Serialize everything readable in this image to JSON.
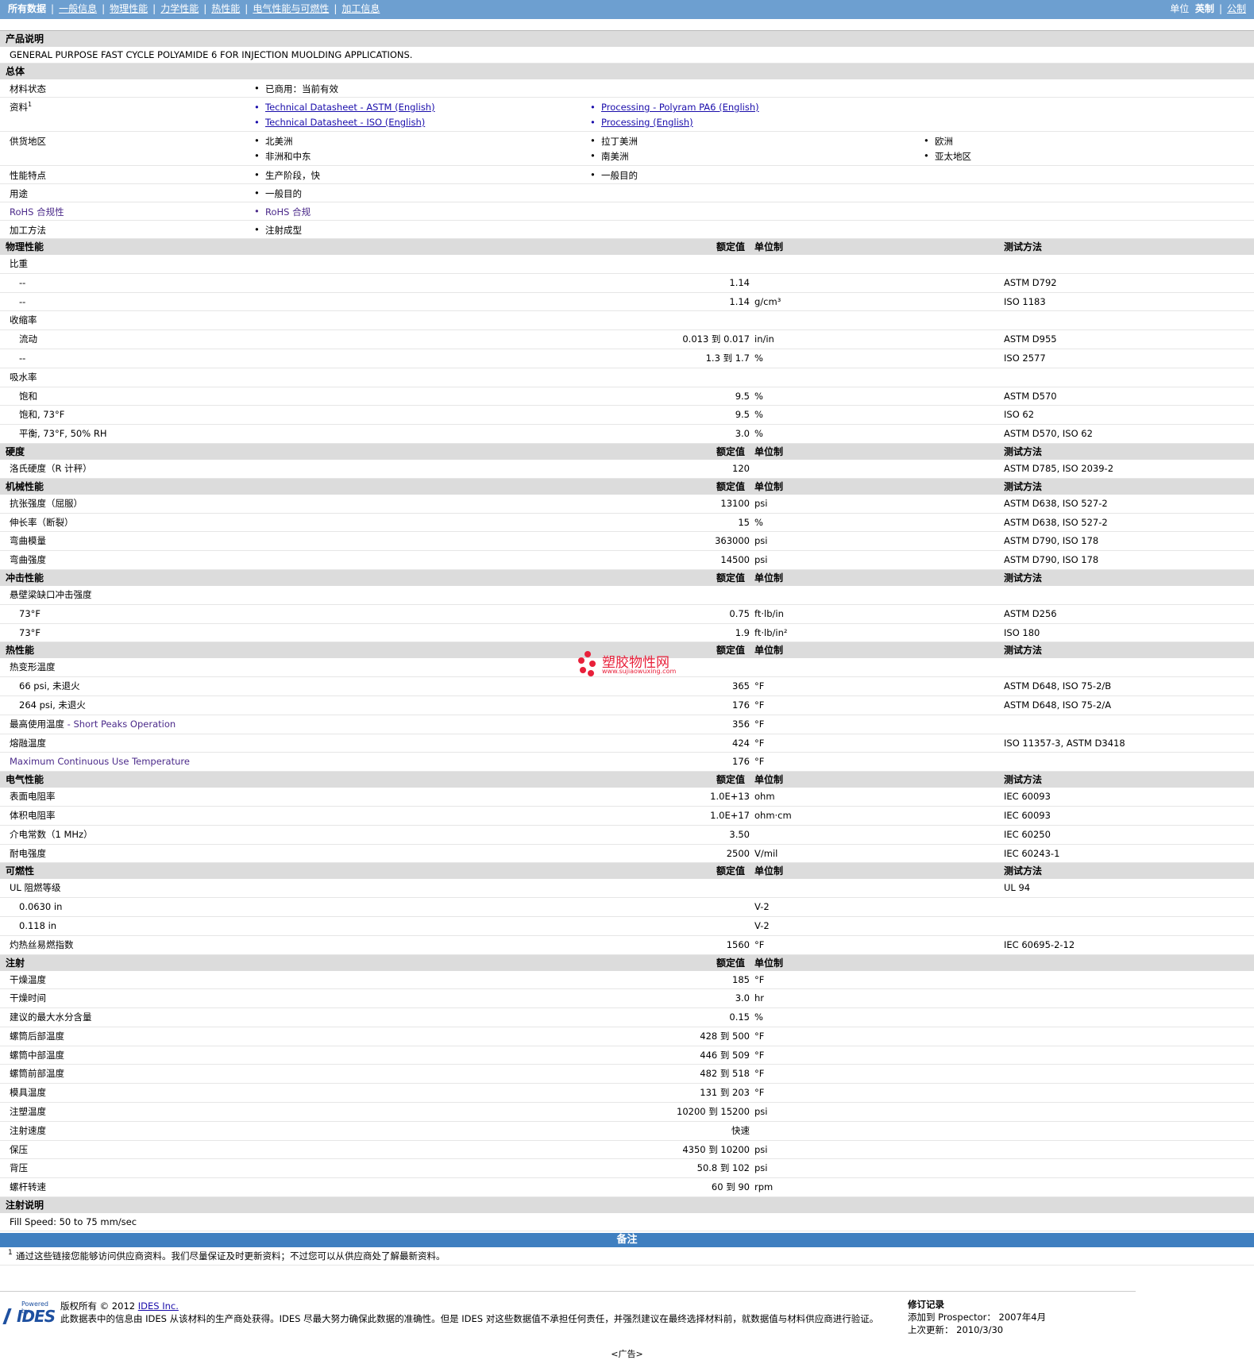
{
  "nav": {
    "items": [
      "所有数据",
      "一般信息",
      "物理性能",
      "力学性能",
      "热性能",
      "电气性能与可燃性",
      "加工信息"
    ],
    "units_label": "单位",
    "units_imperial": "英制",
    "units_metric": "公制"
  },
  "product_desc": {
    "header": "产品说明",
    "text": "GENERAL PURPOSE FAST CYCLE POLYAMIDE 6 FOR INJECTION MUOLDING APPLICATIONS."
  },
  "general": {
    "header": "总体",
    "material_status_label": "材料状态",
    "material_status": "已商用：当前有效",
    "docs_label": "资料",
    "docs_sup": "1",
    "docs": [
      "Technical Datasheet - ASTM (English)",
      "Processing - Polyram PA6 (English)",
      "Technical Datasheet - ISO (English)",
      "Processing (English)"
    ],
    "regions_label": "供货地区",
    "regions": [
      "北美洲",
      "拉丁美洲",
      "欧洲",
      "非洲和中东",
      "南美洲",
      "亚太地区"
    ],
    "features_label": "性能特点",
    "features": [
      "生产阶段，快",
      "一般目的"
    ],
    "uses_label": "用途",
    "uses": "一般目的",
    "rohs_label": "RoHS 合规性",
    "rohs": "RoHS 合规",
    "process_label": "加工方法",
    "process": "注射成型"
  },
  "col_headers": {
    "value": "额定值",
    "unit": "单位制",
    "method": "测试方法"
  },
  "sections": [
    {
      "title": "物理性能",
      "rows": [
        {
          "label": "比重"
        },
        {
          "label": "--",
          "indent": true,
          "value": "1.14",
          "unit": "",
          "method": "ASTM D792"
        },
        {
          "label": "--",
          "indent": true,
          "value": "1.14",
          "unit": "g/cm³",
          "method": "ISO 1183"
        },
        {
          "label": "收缩率"
        },
        {
          "label": "流动",
          "indent": true,
          "value": "0.013 到  0.017",
          "unit": "in/in",
          "method": "ASTM D955"
        },
        {
          "label": "--",
          "indent": true,
          "value": "1.3 到  1.7",
          "unit": "%",
          "method": "ISO 2577"
        },
        {
          "label": "吸水率"
        },
        {
          "label": "饱和",
          "indent": true,
          "value": "9.5",
          "unit": "%",
          "method": "ASTM D570"
        },
        {
          "label": "饱和, 73°F",
          "indent": true,
          "value": "9.5",
          "unit": "%",
          "method": "ISO 62"
        },
        {
          "label": "平衡, 73°F, 50% RH",
          "indent": true,
          "value": "3.0",
          "unit": "%",
          "method": "ASTM D570, ISO 62"
        }
      ]
    },
    {
      "title": "硬度",
      "rows": [
        {
          "label": "洛氏硬度（R 计秤）",
          "value": "120",
          "unit": "",
          "method": "ASTM D785, ISO 2039-2"
        }
      ]
    },
    {
      "title": "机械性能",
      "rows": [
        {
          "label": "抗张强度（屈服）",
          "value": "13100",
          "unit": "psi",
          "method": "ASTM D638, ISO 527-2"
        },
        {
          "label": "伸长率（断裂）",
          "value": "15",
          "unit": "%",
          "method": "ASTM D638, ISO 527-2"
        },
        {
          "label": "弯曲模量",
          "value": "363000",
          "unit": "psi",
          "method": "ASTM D790, ISO 178"
        },
        {
          "label": "弯曲强度",
          "value": "14500",
          "unit": "psi",
          "method": "ASTM D790, ISO 178"
        }
      ]
    },
    {
      "title": "冲击性能",
      "rows": [
        {
          "label": "悬壁梁缺口冲击强度"
        },
        {
          "label": "73°F",
          "indent": true,
          "value": "0.75",
          "unit": "ft·lb/in",
          "method": "ASTM D256"
        },
        {
          "label": "73°F",
          "indent": true,
          "value": "1.9",
          "unit": "ft·lb/in²",
          "method": "ISO 180"
        }
      ]
    },
    {
      "title": "热性能",
      "rows": [
        {
          "label": "热变形温度"
        },
        {
          "label": "66 psi, 未退火",
          "indent": true,
          "value": "365",
          "unit": "°F",
          "method": "ASTM D648, ISO 75-2/B"
        },
        {
          "label": "264 psi, 未退火",
          "indent": true,
          "value": "176",
          "unit": "°F",
          "method": "ASTM D648, ISO 75-2/A"
        },
        {
          "label": "最高使用温度",
          "label_extra": " - Short Peaks Operation",
          "value": "356",
          "unit": "°F",
          "method": ""
        },
        {
          "label": "熔融温度",
          "value": "424",
          "unit": "°F",
          "method": "ISO 11357-3, ASTM D3418"
        },
        {
          "label": "Maximum Continuous Use Temperature",
          "purple": true,
          "value": "176",
          "unit": "°F",
          "method": ""
        }
      ]
    },
    {
      "title": "电气性能",
      "rows": [
        {
          "label": "表面电阻率",
          "value": "1.0E+13",
          "unit": "ohm",
          "method": "IEC 60093"
        },
        {
          "label": "体积电阻率",
          "value": "1.0E+17",
          "unit": "ohm·cm",
          "method": "IEC 60093"
        },
        {
          "label": "介电常数（1 MHz）",
          "value": "3.50",
          "unit": "",
          "method": "IEC 60250"
        },
        {
          "label": "耐电强度",
          "value": "2500",
          "unit": "V/mil",
          "method": "IEC 60243-1"
        }
      ]
    },
    {
      "title": "可燃性",
      "rows": [
        {
          "label": "UL 阻燃等级",
          "value": "",
          "unit": "",
          "method": "UL 94"
        },
        {
          "label": "0.0630 in",
          "indent": true,
          "value": "",
          "unit": "V-2",
          "method": ""
        },
        {
          "label": "0.118 in",
          "indent": true,
          "value": "",
          "unit": "V-2",
          "method": ""
        },
        {
          "label": "灼热丝易燃指数",
          "value": "1560",
          "unit": "°F",
          "method": "IEC 60695-2-12"
        }
      ]
    },
    {
      "title": "注射",
      "no_method": true,
      "rows": [
        {
          "label": "干燥温度",
          "value": "185",
          "unit": "°F"
        },
        {
          "label": "干燥时间",
          "value": "3.0",
          "unit": "hr"
        },
        {
          "label": "建议的最大水分含量",
          "value": "0.15",
          "unit": "%"
        },
        {
          "label": "螺筒后部温度",
          "value": "428 到  500",
          "unit": "°F"
        },
        {
          "label": "螺筒中部温度",
          "value": "446 到  509",
          "unit": "°F"
        },
        {
          "label": "螺筒前部温度",
          "value": "482 到  518",
          "unit": "°F"
        },
        {
          "label": "模具温度",
          "value": "131 到  203",
          "unit": "°F"
        },
        {
          "label": "注塑温度",
          "value": "10200 到  15200",
          "unit": "psi"
        },
        {
          "label": "注射速度",
          "value": "快速",
          "unit": ""
        },
        {
          "label": "保压",
          "value": "4350 到  10200",
          "unit": "psi"
        },
        {
          "label": "背压",
          "value": "50.8 到  102",
          "unit": "psi"
        },
        {
          "label": "螺杆转速",
          "value": "60 到  90",
          "unit": "rpm"
        }
      ]
    }
  ],
  "injection_note": {
    "header": "注射说明",
    "text": "Fill Speed: 50 to 75 mm/sec"
  },
  "remarks": {
    "header": "备注",
    "sup": "1",
    "text": "通过这些链接您能够访问供应商资料。我们尽量保证及时更新资料；不过您可以从供应商处了解最新资料。"
  },
  "watermark": {
    "cn": "塑胶物性网",
    "url": "www.sujiaowuxing.com"
  },
  "footer": {
    "logo_small": "Powered by",
    "logo_big": "IDES",
    "copyright_prefix": "版权所有  © 2012 ",
    "copyright_link": "IDES Inc.",
    "disclaimer": "此数据表中的信息由 IDES 从该材料的生产商处获得。IDES 尽最大努力确保此数据的准确性。但是 IDES 对这些数据值不承担任何责任，并强烈建议在最终选择材料前，就数据值与材料供应商进行验证。",
    "rev_title": "修订记录",
    "rev_added": "添加到 Prospector：  2007年4月",
    "rev_updated": "上次更新：  2010/3/30",
    "ad": "<广告>"
  }
}
